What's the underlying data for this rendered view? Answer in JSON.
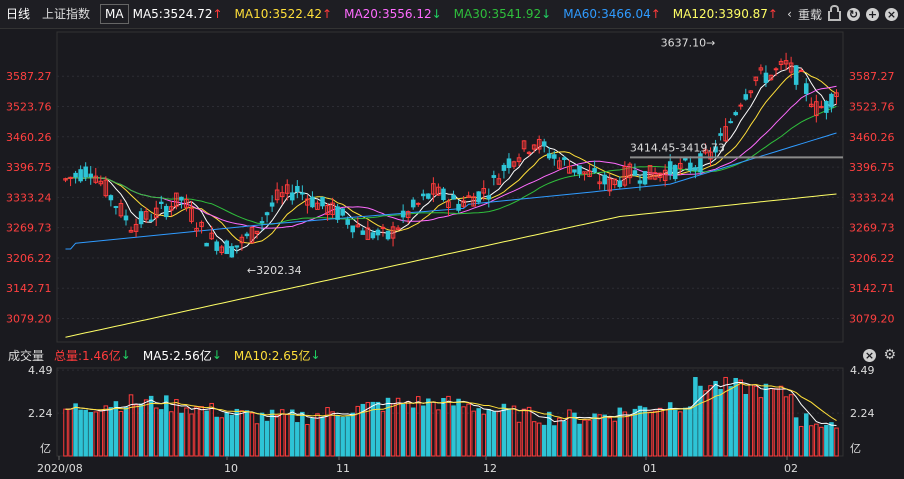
{
  "header": {
    "tabs": [
      "日线",
      "上证指数"
    ],
    "ma_selector": "MA",
    "ma_items": [
      {
        "label": "MA5:3524.72",
        "arrow": "↑",
        "color": "#ffffff"
      },
      {
        "label": "MA10:3522.42",
        "arrow": "↑",
        "color": "#ffdf3a"
      },
      {
        "label": "MA20:3556.12",
        "arrow": "↓",
        "color": "#ff6bff"
      },
      {
        "label": "MA30:3541.92",
        "arrow": "↓",
        "color": "#2fbf3c"
      },
      {
        "label": "MA60:3466.04",
        "arrow": "↑",
        "color": "#2f9bff"
      },
      {
        "label": "MA120:3390.87",
        "arrow": "↑",
        "color": "#ffff66"
      }
    ],
    "back_icon": "chevron-left-icon",
    "fuquan_label": "重载",
    "lock_icon": "lock-icon",
    "refresh_icon": "refresh-icon",
    "plus_icon": "plus-circle-icon",
    "close_icon": "close-circle-icon"
  },
  "volume_header": {
    "title": "成交量",
    "total_label": "总量:1.46亿",
    "total_arrow": "↓",
    "ma5_label": "MA5:2.56亿",
    "ma5_arrow": "↓",
    "ma10_label": "MA10:2.65亿",
    "ma10_arrow": "↓",
    "close_icon": "close-circle-icon",
    "settings_icon": "gear-icon"
  },
  "colors": {
    "up": "#ff3b3b",
    "down": "#2ec4d6",
    "grid": "#2c2c33",
    "axis_text": "#ff4040"
  },
  "chart_data": [
    {
      "type": "candlestick",
      "title": "上证指数",
      "y_ticks": [
        3587.27,
        3523.76,
        3460.26,
        3396.75,
        3333.24,
        3269.73,
        3206.22,
        3142.71,
        3079.2
      ],
      "ylim": [
        3030,
        3680
      ],
      "annotations": [
        {
          "text": "3637.10→",
          "value": 3637.1,
          "index": 130
        },
        {
          "text": "←3202.34",
          "value": 3202.34,
          "index": 36
        },
        {
          "text": "3414.45-3419.73",
          "value": 3417.0,
          "index": 112
        }
      ],
      "grid": true,
      "series_ma": [
        "MA5",
        "MA10",
        "MA20",
        "MA30",
        "MA60",
        "MA120"
      ]
    },
    {
      "type": "bar",
      "title": "成交量",
      "y_ticks": [
        "4.49",
        "2.24",
        "亿"
      ],
      "ylim": [
        0,
        4.6
      ]
    }
  ],
  "x_axis": {
    "labels": [
      "2020/08",
      "10",
      "11",
      "12",
      "01",
      "02"
    ]
  }
}
